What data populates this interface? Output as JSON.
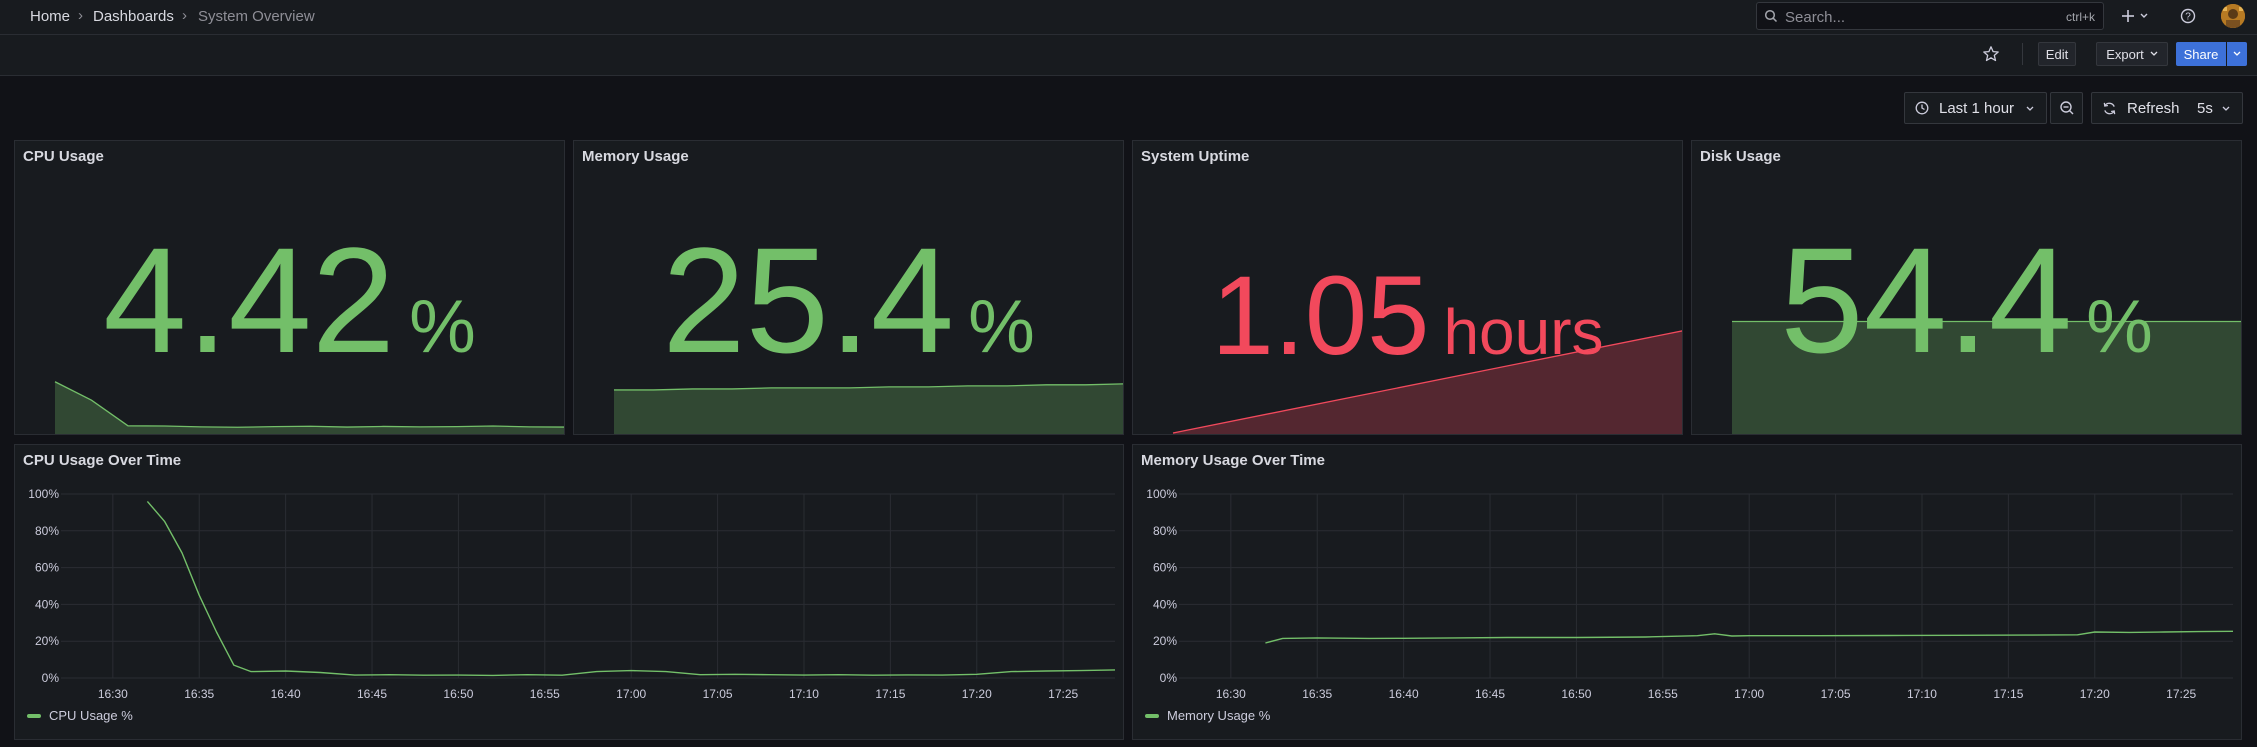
{
  "breadcrumb": [
    "Home",
    "Dashboards",
    "System Overview"
  ],
  "search": {
    "placeholder": "Search...",
    "shortcut": "ctrl+k"
  },
  "toolbar": {
    "edit_label": "Edit",
    "export_label": "Export",
    "share_label": "Share"
  },
  "timepicker": {
    "label": "Last 1 hour"
  },
  "refresh": {
    "label": "Refresh",
    "interval": "5s"
  },
  "colors": {
    "green": "#73bf69",
    "red": "#f2495c",
    "accent": "#3d71d9"
  },
  "stats": [
    {
      "title": "CPU Usage",
      "value": "4.42",
      "unit": "%",
      "color": "#73bf69",
      "spark": [
        0.25,
        0.16,
        0.035,
        0.034,
        0.03,
        0.028,
        0.031,
        0.033,
        0.029,
        0.032,
        0.03,
        0.031,
        0.034,
        0.03,
        0.029
      ]
    },
    {
      "title": "Memory Usage",
      "value": "25.4",
      "unit": "%",
      "color": "#73bf69",
      "spark": [
        0.21,
        0.21,
        0.215,
        0.215,
        0.22,
        0.22,
        0.22,
        0.225,
        0.225,
        0.23,
        0.23,
        0.235,
        0.235,
        0.24
      ]
    },
    {
      "title": "System Uptime",
      "value": "1.05",
      "unit": "hours",
      "color": "#f2495c",
      "spark": [
        0.0,
        0.5
      ]
    },
    {
      "title": "Disk Usage",
      "value": "54.4",
      "unit": "%",
      "color": "#73bf69",
      "spark": [
        0.544,
        0.544
      ]
    }
  ],
  "chart_data": [
    {
      "type": "line",
      "title": "CPU Usage Over Time",
      "xlabel": "",
      "ylabel": "",
      "ylim": [
        0,
        100
      ],
      "y_ticks": [
        "0%",
        "20%",
        "40%",
        "60%",
        "80%",
        "100%"
      ],
      "x_ticks": [
        "16:30",
        "16:35",
        "16:40",
        "16:45",
        "16:50",
        "16:55",
        "17:00",
        "17:05",
        "17:10",
        "17:15",
        "17:20",
        "17:25"
      ],
      "xlim": [
        "16:27",
        "17:28"
      ],
      "series": [
        {
          "name": "CPU Usage %",
          "color": "#73bf69",
          "x": [
            "16:32",
            "16:33",
            "16:34",
            "16:35",
            "16:36",
            "16:37",
            "16:38",
            "16:40",
            "16:42",
            "16:44",
            "16:46",
            "16:48",
            "16:50",
            "16:52",
            "16:54",
            "16:56",
            "16:58",
            "17:00",
            "17:02",
            "17:04",
            "17:06",
            "17:08",
            "17:10",
            "17:12",
            "17:14",
            "17:16",
            "17:18",
            "17:20",
            "17:22",
            "17:24",
            "17:26",
            "17:28"
          ],
          "y": [
            96,
            85,
            68,
            45,
            25,
            7,
            3.5,
            3.8,
            3,
            1.6,
            1.8,
            1.5,
            1.6,
            1.4,
            1.8,
            1.5,
            3.5,
            4,
            3.5,
            1.8,
            2,
            1.8,
            1.6,
            1.8,
            1.5,
            1.7,
            1.6,
            2,
            3.5,
            3.8,
            4,
            4.4
          ]
        }
      ]
    },
    {
      "type": "line",
      "title": "Memory Usage Over Time",
      "xlabel": "",
      "ylabel": "",
      "ylim": [
        0,
        100
      ],
      "y_ticks": [
        "0%",
        "20%",
        "40%",
        "60%",
        "80%",
        "100%"
      ],
      "x_ticks": [
        "16:30",
        "16:35",
        "16:40",
        "16:45",
        "16:50",
        "16:55",
        "17:00",
        "17:05",
        "17:10",
        "17:15",
        "17:20",
        "17:25"
      ],
      "xlim": [
        "16:27",
        "17:28"
      ],
      "series": [
        {
          "name": "Memory Usage %",
          "color": "#73bf69",
          "x": [
            "16:32",
            "16:33",
            "16:35",
            "16:38",
            "16:40",
            "16:43",
            "16:46",
            "16:50",
            "16:54",
            "16:57",
            "16:58",
            "16:59",
            "17:00",
            "17:04",
            "17:08",
            "17:12",
            "17:16",
            "17:19",
            "17:20",
            "17:22",
            "17:24",
            "17:26",
            "17:28"
          ],
          "y": [
            19,
            21.5,
            21.8,
            21.5,
            21.6,
            21.8,
            22,
            22,
            22.3,
            23,
            24,
            22.8,
            23,
            23,
            23.1,
            23.2,
            23.3,
            23.5,
            25,
            24.8,
            25,
            25.2,
            25.4
          ]
        }
      ]
    }
  ]
}
